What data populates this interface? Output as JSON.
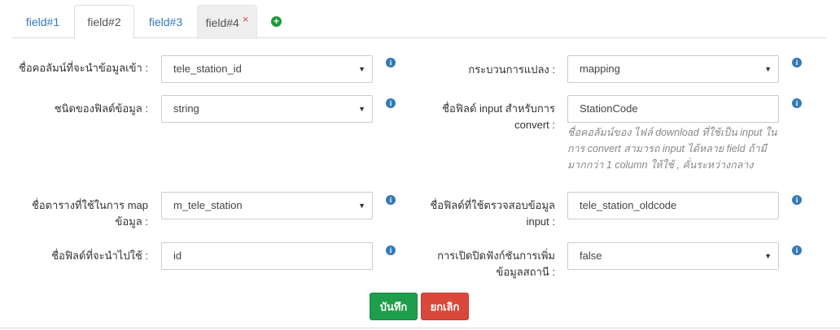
{
  "tabs": [
    {
      "label": "field#1"
    },
    {
      "label": "field#2"
    },
    {
      "label": "field#3"
    },
    {
      "label": "field#4",
      "close": "×"
    }
  ],
  "add_tab_icon": "plus-circle-icon",
  "form": {
    "source_column": {
      "label": "ชื่อคอลัมน์ที่จะนำข้อมูลเข้า :",
      "value": "tele_station_id"
    },
    "process": {
      "label": "กระบวนการแปลง :",
      "value": "mapping"
    },
    "field_type": {
      "label": "ชนิดของฟิลด์ข้อมูล :",
      "value": "string"
    },
    "input_field": {
      "label_line1": "ชื่อฟิลด์ input สำหรับการ",
      "label_line2": "convert :",
      "value": "StationCode",
      "help_line1": "ชื่อคอลัมน์ของ ไฟล์ download ที่ใช้เป็น input ใน",
      "help_line2": "การ convert สามารถ input ได้หลาย field ถ้ามี",
      "help_line3": "มากกว่า 1 column ให้ใช้ , คั่นระหว่างกลาง"
    },
    "map_table": {
      "label_line1": "ชื่อตารางที่ใช้ในการ map",
      "label_line2": "ข้อมูล :",
      "value": "m_tele_station"
    },
    "check_field": {
      "label_line1": "ชื่อฟิลด์ที่ใช้ตรวจสอบข้อมูล",
      "label_line2": "input :",
      "value": "tele_station_oldcode"
    },
    "target_field": {
      "label": "ชื่อฟิลด์ที่จะนำไปใช้ :",
      "value": "id"
    },
    "add_station": {
      "label_line1": "การเปิดปิดฟังก์ชันการเพิ่ม",
      "label_line2": "ข้อมูลสถานี :",
      "value": "false"
    }
  },
  "buttons": {
    "save": "บันทึก",
    "cancel": "ยกเลิก"
  },
  "colors": {
    "link": "#337ab7",
    "save": "#1e9e4a",
    "cancel": "#d9483b",
    "add": "#1a9a3a"
  }
}
